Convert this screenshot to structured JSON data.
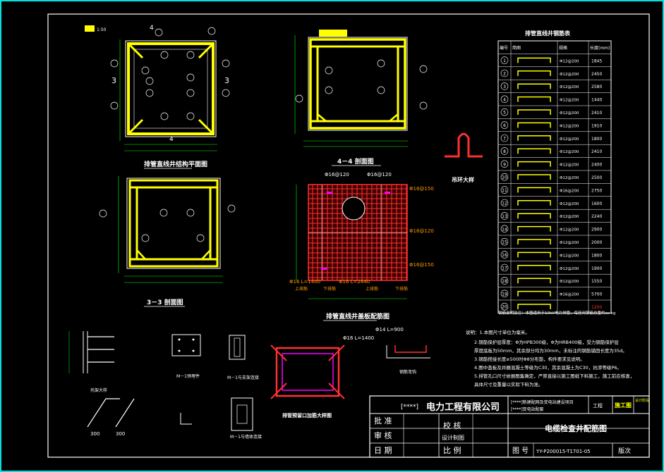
{
  "titles": {
    "plan": "排管直线井结构平面图",
    "sec44": "4－4 剖面图",
    "sec33": "3－3 剖面图",
    "slab": "排管直线井盖板配筋图",
    "hook": "吊环大样",
    "corbel": "托架大样",
    "m1": "M－1预埋件",
    "m1wall": "M－1与支架连接",
    "m1wall2": "M－1与墙体连接",
    "hole": "排管预留口加筋大样图",
    "bend": "钢筋弯钩"
  },
  "scale": "1:50",
  "rebar_table": {
    "title": "排管直线井钢筋表",
    "headers": [
      "编号",
      "简图",
      "规格",
      "长度(mm)"
    ],
    "rows": [
      [
        "1",
        "",
        "Φ12@200",
        "1845"
      ],
      [
        "2",
        "",
        "Φ12@200",
        "2450"
      ],
      [
        "3",
        "",
        "Φ12@200",
        "2580"
      ],
      [
        "4",
        "",
        "Φ12@200",
        "1440"
      ],
      [
        "5",
        "",
        "Φ12@200",
        "2410"
      ],
      [
        "6",
        "",
        "Φ12@200",
        "1910"
      ],
      [
        "7",
        "",
        "Φ12@200",
        "1800"
      ],
      [
        "8",
        "",
        "Φ12@200",
        "2410"
      ],
      [
        "9",
        "",
        "Φ12@200",
        "2400"
      ],
      [
        "10",
        "",
        "Φ12@200",
        "2500"
      ],
      [
        "11",
        "",
        "Φ16@200",
        "2750"
      ],
      [
        "12",
        "",
        "Φ12@200",
        "1600"
      ],
      [
        "13",
        "",
        "Φ12@200",
        "2240"
      ],
      [
        "14",
        "",
        "Φ12@200",
        "2900"
      ],
      [
        "15",
        "",
        "Φ12@200",
        "2000"
      ],
      [
        "16",
        "",
        "Φ12@200",
        "1800"
      ],
      [
        "17",
        "",
        "Φ12@200",
        "1900"
      ],
      [
        "18",
        "",
        "Φ12@200",
        "1550"
      ],
      [
        "19",
        "",
        "Φ16@200",
        "5700"
      ],
      [
        "20",
        "",
        "",
        "1200"
      ]
    ],
    "note": "钢筋说明及注：本图适用于10kV电力排管，每座用钢筋总重约xx kg"
  },
  "notes": [
    "说明：1.本图尺寸单位为毫米。",
    "2.钢筋保护层厚度：Φ为HPB300级，Φ为HRB400级，受力钢筋保护层",
    "厚度底板为50mm，其余部分均为30mm，未标注的钢筋锚固长度为35d。",
    "3.钢筋搭接长度≥500时Φ8分布筋，构件要求见说明。",
    "4.图中盖板及井圈混凝土等级为C30，其余混凝土为C30，抗渗等级P6。",
    "5.排管孔口尺寸依据图集确定，严禁直接以施工图纸下料施工，施工前应核查，",
    "具体尺寸及重量以实际下料为准。"
  ],
  "slab_labels": [
    "Φ16@120",
    "Φ16@120",
    "Φ16@150",
    "Φ16@120",
    "Φ16@150",
    "Φ16 L=1400",
    "Φ16 L=2840",
    "上排筋",
    "下排筋",
    "上排筋",
    "下排筋",
    "Φ14 L=900",
    "上排筋",
    "下排筋",
    "Φ16 L=1400"
  ],
  "title_block": {
    "company_prefix": "[****]",
    "company": "电力工程有限公司",
    "project_line1": "[****]新建配网及变电站建设项目",
    "project_line2": "[****]变电站配套",
    "project_label": "工程",
    "stage": "施工图",
    "stage2": "设计阶段",
    "drawing_title": "电缆检查井配筋图",
    "approve": "批  准",
    "check": "校  核",
    "review": "审  核",
    "design": "设计制图",
    "date": "日  期",
    "scale_label": "比  例",
    "drawing_no_label": "图  号",
    "drawing_no": "YY-P200015-T1701-05",
    "version": "版次"
  },
  "colors": {
    "frame": "#ffffff",
    "border": "#00e0e0",
    "rebar": "#ffff00",
    "slab": "#ff3030",
    "text": "#ffffff",
    "dim": "#00ff00",
    "cyan": "#00ffff",
    "orange": "#ff9900",
    "magenta": "#ff00ff"
  }
}
